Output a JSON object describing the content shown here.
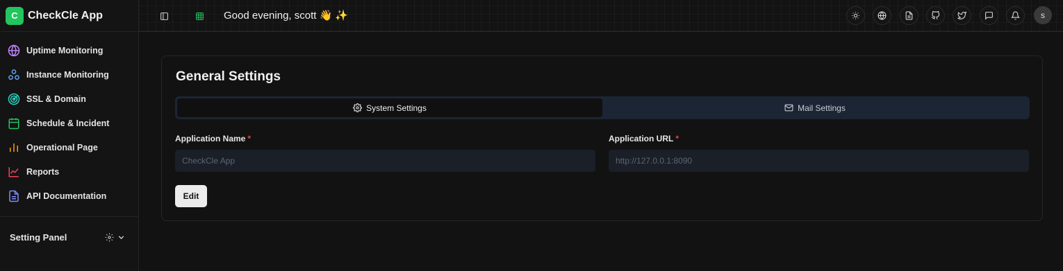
{
  "app": {
    "logo_letter": "C",
    "name": "CheckCle App"
  },
  "sidebar": {
    "items": [
      {
        "label": "Uptime Monitoring",
        "icon": "globe-icon",
        "color": "#c084fc"
      },
      {
        "label": "Instance Monitoring",
        "icon": "network-icon",
        "color": "#60a5fa"
      },
      {
        "label": "SSL & Domain",
        "icon": "radar-icon",
        "color": "#2dd4bf"
      },
      {
        "label": "Schedule & Incident",
        "icon": "calendar-icon",
        "color": "#22c55e"
      },
      {
        "label": "Operational Page",
        "icon": "bar-chart-icon",
        "color": "#f59e0b"
      },
      {
        "label": "Reports",
        "icon": "line-chart-icon",
        "color": "#f43f5e"
      },
      {
        "label": "API Documentation",
        "icon": "document-icon",
        "color": "#818cf8"
      }
    ],
    "setting_panel_label": "Setting Panel"
  },
  "header": {
    "greeting": "Good evening, scott 👋 ✨",
    "avatar_letter": "s",
    "actions": [
      "theme-toggle-icon",
      "globe-icon",
      "docs-icon",
      "github-icon",
      "twitter-icon",
      "chat-icon",
      "bell-icon"
    ]
  },
  "main": {
    "title": "General Settings",
    "tabs": [
      {
        "label": "System Settings",
        "icon": "gear-icon",
        "active": true
      },
      {
        "label": "Mail Settings",
        "icon": "mail-icon",
        "active": false
      }
    ],
    "fields": [
      {
        "label": "Application Name",
        "required_mark": "*",
        "value": "",
        "placeholder": "CheckCle App"
      },
      {
        "label": "Application URL",
        "required_mark": "*",
        "value": "",
        "placeholder": "http://127.0.0.1:8090"
      }
    ],
    "edit_label": "Edit"
  },
  "colors": {
    "brand": "#22c55e",
    "background": "#121212",
    "tabs_bg": "#1c2533",
    "required": "#d84a4a"
  }
}
